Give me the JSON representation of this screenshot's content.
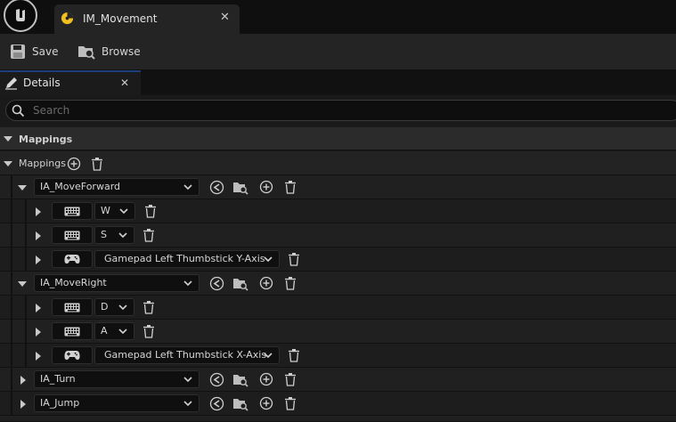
{
  "window": {
    "tab_title": "IM_Movement",
    "tab_close": "✕"
  },
  "toolbar": {
    "save_label": "Save",
    "browse_label": "Browse"
  },
  "details_tab": {
    "label": "Details",
    "close": "✕"
  },
  "search": {
    "placeholder": "Search"
  },
  "category": {
    "label": "Mappings"
  },
  "mappings_array": {
    "label": "Mappings"
  },
  "actions": [
    {
      "name": "IA_MoveForward",
      "keys": [
        {
          "device": "keyboard-icon",
          "key": "W"
        },
        {
          "device": "keyboard-icon",
          "key": "S"
        },
        {
          "device": "gamepad-icon",
          "key": "Gamepad Left Thumbstick Y-Axis"
        }
      ]
    },
    {
      "name": "IA_MoveRight",
      "keys": [
        {
          "device": "keyboard-icon",
          "key": "D"
        },
        {
          "device": "keyboard-icon",
          "key": "A"
        },
        {
          "device": "gamepad-icon",
          "key": "Gamepad Left Thumbstick X-Axis"
        }
      ]
    },
    {
      "name": "IA_Turn",
      "keys": []
    },
    {
      "name": "IA_Jump",
      "keys": []
    }
  ],
  "colors": {
    "background": "#151515",
    "panel": "#1a1a1a",
    "accent": "#1c3e7a",
    "tab_icon": "#f0c020"
  }
}
